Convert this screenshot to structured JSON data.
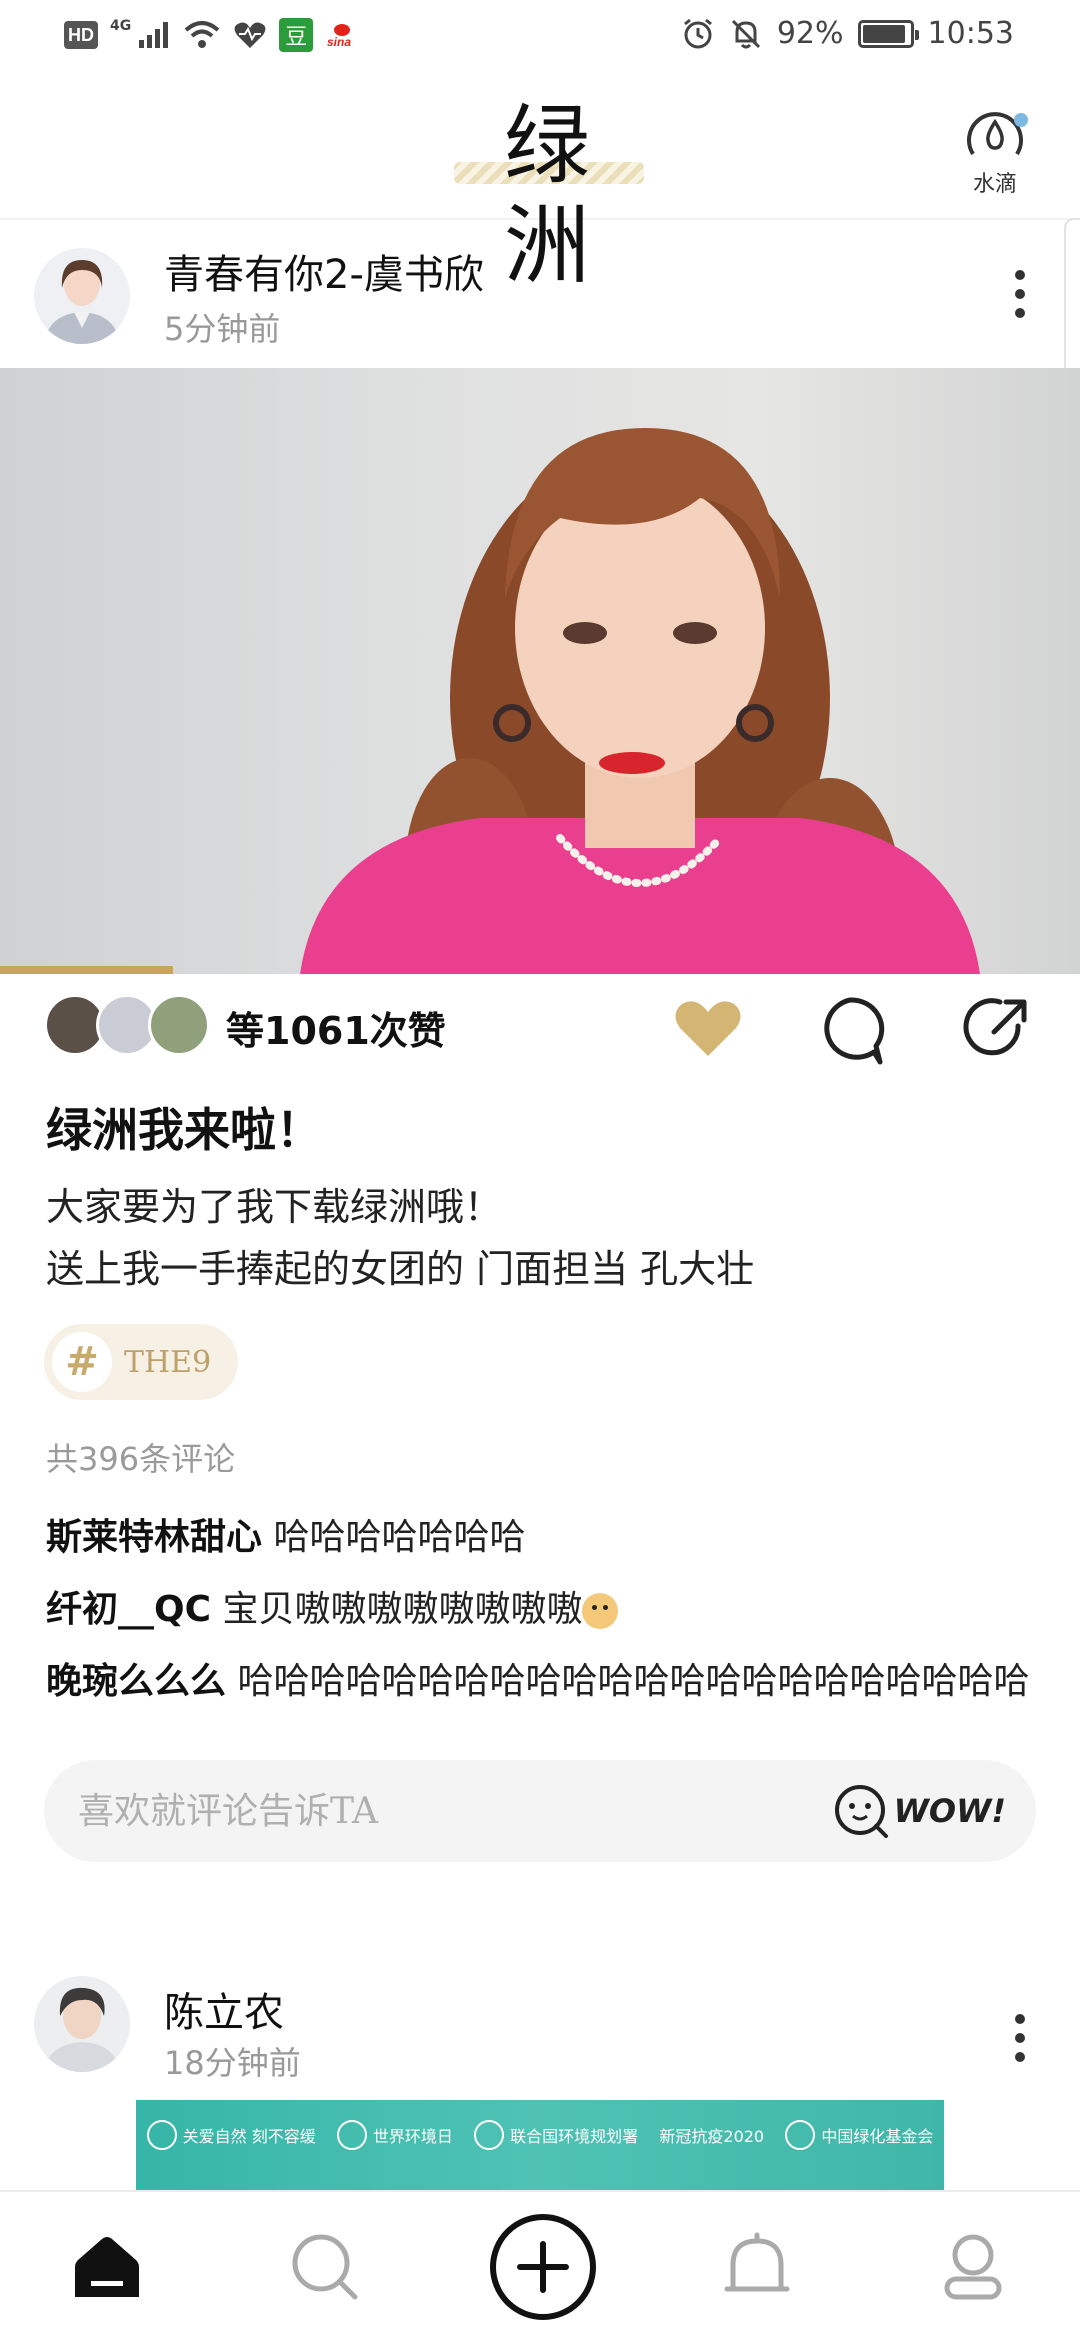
{
  "status_bar": {
    "hd": "HD",
    "network": "4G",
    "douban": "豆",
    "sina": "sina",
    "battery": "92%",
    "battery_level": 0.92,
    "time": "10:53"
  },
  "header": {
    "logo": "绿洲",
    "water_label": "水滴"
  },
  "post1": {
    "author": "青春有你2-虞书欣",
    "time_ago": "5分钟前",
    "video_progress": 0.16,
    "likes_text": "等1061次赞",
    "title": "绿洲我来啦！",
    "body_lines": [
      "大家要为了我下载绿洲哦！",
      "送上我一手捧起的女团的 门面担当 孔大壮"
    ],
    "topic_hash": "#",
    "topic": "THE9",
    "comment_count": "共396条评论",
    "comments": [
      {
        "user": "斯莱特林甜心",
        "text": " 哈哈哈哈哈哈哈"
      },
      {
        "user": "纤初__QC",
        "text": " 宝贝嗷嗷嗷嗷嗷嗷嗷嗷"
      },
      {
        "user": "晚琬么么么",
        "text": " 哈哈哈哈哈哈哈哈哈哈哈哈哈哈哈哈哈哈哈哈哈哈"
      }
    ],
    "input_placeholder": "喜欢就评论告诉TA",
    "wow": "WOW!"
  },
  "post2": {
    "author": "陈立农",
    "time_ago": "18分钟前",
    "banner_items": [
      "关爱自然 刻不容缓",
      "世界环境日",
      "联合国环境规划署",
      "新冠抗疫2020",
      "中国绿化基金会"
    ]
  },
  "nav": {
    "items": [
      "home-icon",
      "search-icon",
      "add-icon",
      "notification-icon",
      "profile-icon"
    ]
  },
  "colors": {
    "accent_gold": "#c9a45c",
    "heart": "#d4b574",
    "water_dot": "#7db8e0"
  }
}
